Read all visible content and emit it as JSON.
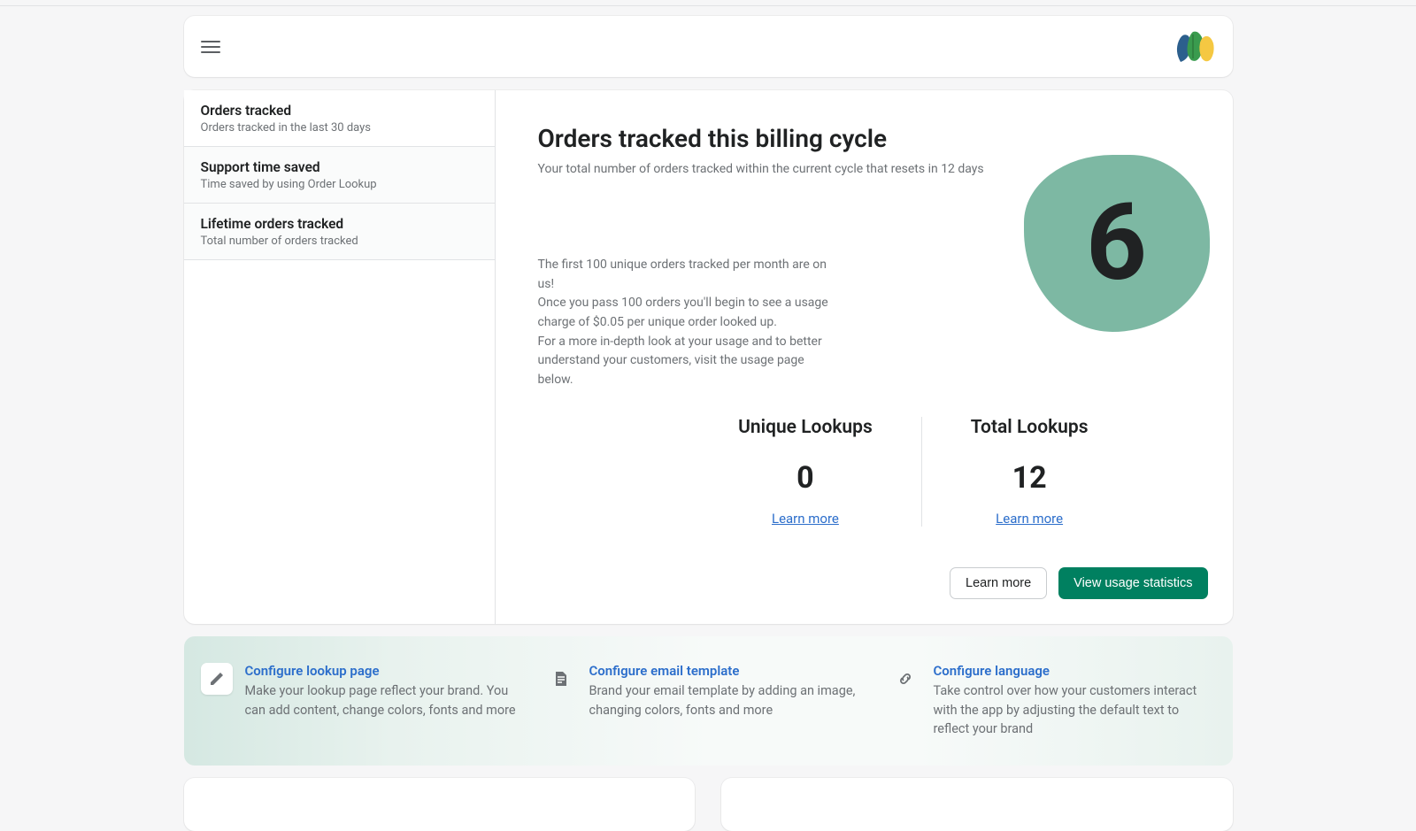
{
  "sidebar": {
    "items": [
      {
        "title": "Orders tracked",
        "subtitle": "Orders tracked in the last 30 days"
      },
      {
        "title": "Support time saved",
        "subtitle": "Time saved by using Order Lookup"
      },
      {
        "title": "Lifetime orders tracked",
        "subtitle": "Total number of orders tracked"
      }
    ]
  },
  "main": {
    "title": "Orders tracked this billing cycle",
    "subtitle": "Your total number of orders tracked within the current cycle that resets in 12 days",
    "description_line1": "The first 100 unique orders tracked per month are on us!",
    "description_line2": "Once you pass 100 orders you'll begin to see a usage charge of $0.05 per unique order looked up.",
    "description_line3": "For a more in-depth look at your usage and to better understand your customers, visit the usage page below.",
    "big_number": "6"
  },
  "stats": {
    "unique": {
      "label": "Unique Lookups",
      "value": "0",
      "link": "Learn more"
    },
    "total": {
      "label": "Total Lookups",
      "value": "12",
      "link": "Learn more"
    }
  },
  "actions": {
    "learn_more": "Learn more",
    "view_usage": "View usage statistics"
  },
  "config": [
    {
      "title": "Configure lookup page",
      "description": "Make your lookup page reflect your brand. You can add content, change colors, fonts and more"
    },
    {
      "title": "Configure email template",
      "description": "Brand your email template by adding an image, changing colors, fonts and more"
    },
    {
      "title": "Configure language",
      "description": "Take control over how your customers interact with the app by adjusting the default text to reflect your brand"
    }
  ]
}
